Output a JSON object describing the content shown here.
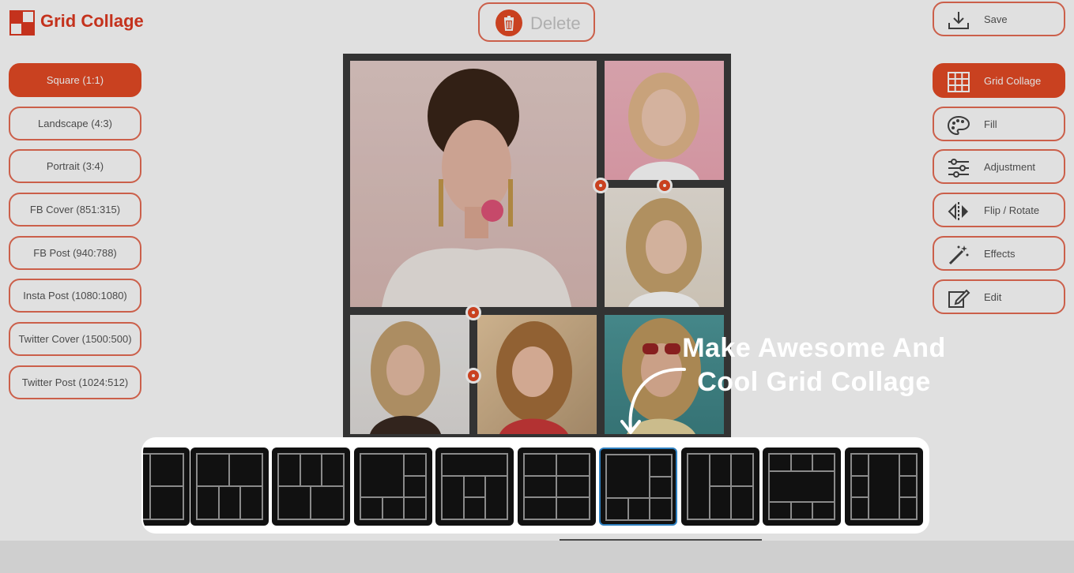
{
  "header": {
    "app_title": "Grid Collage",
    "delete_label": "Delete",
    "save_label": "Save"
  },
  "ratios": [
    {
      "label": "Square (1:1)",
      "active": true
    },
    {
      "label": "Landscape (4:3)",
      "active": false
    },
    {
      "label": "Portrait (3:4)",
      "active": false
    },
    {
      "label": "FB Cover (851:315)",
      "active": false
    },
    {
      "label": "FB Post (940:788)",
      "active": false
    },
    {
      "label": "Insta Post (1080:1080)",
      "active": false
    },
    {
      "label": "Twitter Cover (1500:500)",
      "active": false
    },
    {
      "label": "Twitter Post (1024:512)",
      "active": false
    }
  ],
  "tools": [
    {
      "label": "Grid Collage",
      "icon": "grid-icon",
      "active": true
    },
    {
      "label": "Fill",
      "icon": "palette-icon",
      "active": false
    },
    {
      "label": "Adjustment",
      "icon": "sliders-icon",
      "active": false
    },
    {
      "label": "Flip / Rotate",
      "icon": "flip-icon",
      "active": false
    },
    {
      "label": "Effects",
      "icon": "magic-wand-icon",
      "active": false
    },
    {
      "label": "Edit",
      "icon": "edit-icon",
      "active": false
    }
  ],
  "callout": {
    "line1": "Make Awesome And",
    "line2": "Cool Grid Collage"
  },
  "layouts": {
    "count_visible": 10,
    "selected_index": 6
  },
  "colors": {
    "accent": "#e54a25",
    "accent_border": "#e86d55",
    "selection": "#2d7fc0"
  }
}
